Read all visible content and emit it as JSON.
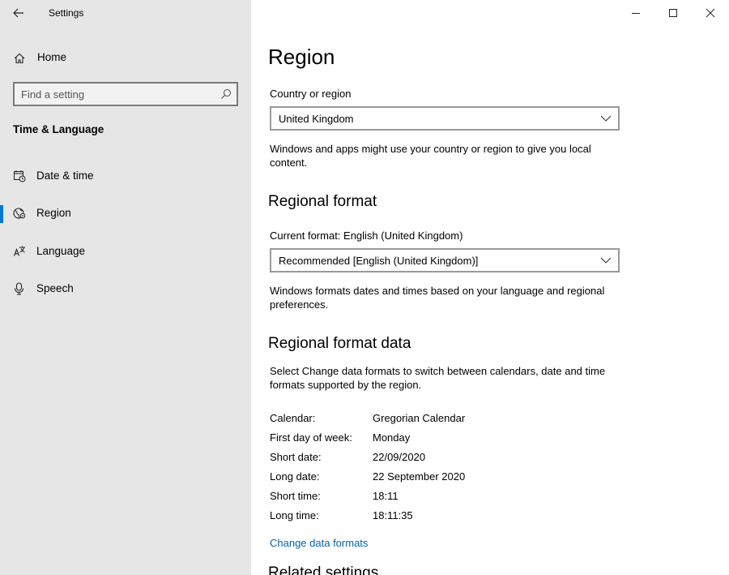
{
  "window": {
    "title": "Settings",
    "controls": {
      "minimize": "minimize",
      "maximize": "maximize",
      "close": "close"
    }
  },
  "sidebar": {
    "home_label": "Home",
    "search_placeholder": "Find a setting",
    "section_title": "Time & Language",
    "items": [
      {
        "label": "Date & time",
        "icon": "calendar-clock-icon",
        "selected": false
      },
      {
        "label": "Region",
        "icon": "globe-icon",
        "selected": true
      },
      {
        "label": "Language",
        "icon": "language-icon",
        "selected": false
      },
      {
        "label": "Speech",
        "icon": "microphone-icon",
        "selected": false
      }
    ]
  },
  "main": {
    "title": "Region",
    "country": {
      "label": "Country or region",
      "value": "United Kingdom",
      "description": "Windows and apps might use your country or region to give you local content."
    },
    "regional_format": {
      "heading": "Regional format",
      "current_label": "Current format: English (United Kingdom)",
      "value": "Recommended [English (United Kingdom)]",
      "description": "Windows formats dates and times based on your language and regional preferences."
    },
    "format_data": {
      "heading": "Regional format data",
      "description": "Select Change data formats to switch between calendars, date and time formats supported by the region.",
      "rows": [
        {
          "key": "Calendar:",
          "value": "Gregorian Calendar"
        },
        {
          "key": "First day of week:",
          "value": "Monday"
        },
        {
          "key": "Short date:",
          "value": "22/09/2020"
        },
        {
          "key": "Long date:",
          "value": "22 September 2020"
        },
        {
          "key": "Short time:",
          "value": "18:11"
        },
        {
          "key": "Long time:",
          "value": "18:11:35"
        }
      ],
      "link": "Change data formats"
    },
    "related_heading": "Related settings"
  },
  "colors": {
    "accent": "#0078d7",
    "link": "#0063b1",
    "sidebar_bg": "#e6e6e6"
  }
}
